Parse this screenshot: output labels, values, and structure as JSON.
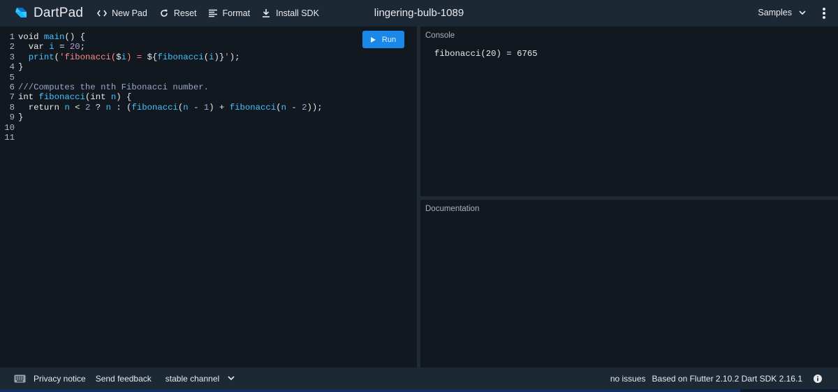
{
  "header": {
    "logo_text": "DartPad",
    "new_pad": "New Pad",
    "reset": "Reset",
    "format": "Format",
    "install_sdk": "Install SDK",
    "pad_title": "lingering-bulb-1089",
    "samples": "Samples"
  },
  "editor": {
    "run_label": "Run",
    "line_numbers": [
      "1",
      "2",
      "3",
      "4",
      "5",
      "6",
      "7",
      "8",
      "9",
      "10",
      "11"
    ]
  },
  "console": {
    "label": "Console",
    "output": "fibonacci(20) = 6765"
  },
  "documentation": {
    "label": "Documentation"
  },
  "footer": {
    "privacy": "Privacy notice",
    "feedback": "Send feedback",
    "channel": "stable channel",
    "issues": "no issues",
    "sdk_info": "Based on Flutter 2.10.2 Dart SDK 2.16.1"
  },
  "colors": {
    "header_bg": "#1c2834",
    "editor_bg": "#12181f",
    "accent_blue": "#1a88e8",
    "function_color": "#40c4ff",
    "string_color": "#ff8a8a",
    "number_color": "#b39ddb"
  },
  "icons": [
    "dart-logo",
    "code-icon",
    "refresh-icon",
    "format-lines-icon",
    "download-icon",
    "chevron-down-icon",
    "more-vert-icon",
    "play-icon",
    "keyboard-icon",
    "info-icon"
  ]
}
